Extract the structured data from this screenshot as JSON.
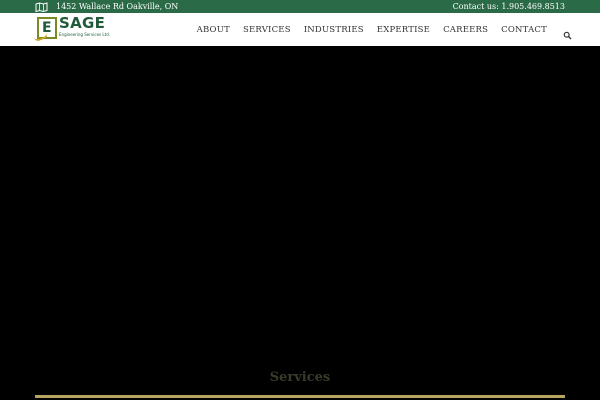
{
  "topbar": {
    "address": "1452 Wallace Rd Oakville, ON",
    "contact": "Contact us: 1.905.469.8513",
    "icon": "map-icon"
  },
  "logo": {
    "name": "SAGE",
    "tagline": "Engineering Services Ltd.",
    "mark_letter": "E"
  },
  "nav": {
    "items": [
      "ABOUT",
      "SERVICES",
      "INDUSTRIES",
      "EXPERTISE",
      "CAREERS",
      "CONTACT"
    ],
    "search_icon": "search-icon"
  },
  "hero": {
    "section_title": "Services"
  },
  "colors": {
    "topbar": "#2b6a47",
    "brand_green": "#1f5a3a",
    "gold": "#b7a460",
    "hero_bg": "#000000"
  }
}
